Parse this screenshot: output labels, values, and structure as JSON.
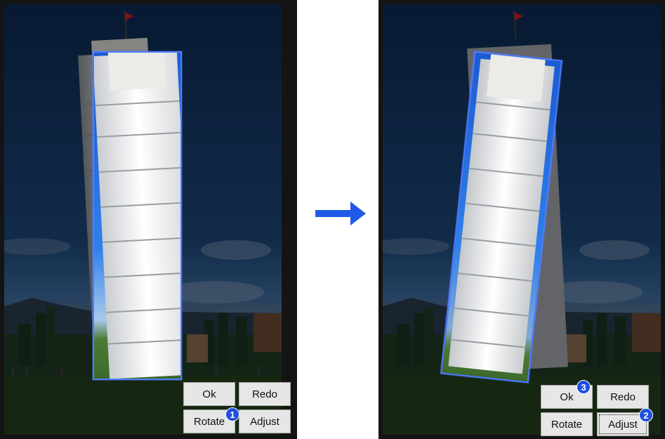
{
  "left_panel": {
    "photo_description_icon": "leaning-tower-photo",
    "buttons": {
      "ok": "Ok",
      "redo": "Redo",
      "rotate": "Rotate",
      "adjust": "Adjust"
    },
    "badges": {
      "rotate": "1"
    }
  },
  "transition": {
    "arrow_icon": "arrow-right-icon",
    "arrow_color": "#1f5be8"
  },
  "right_panel": {
    "buttons": {
      "ok": "Ok",
      "redo": "Redo",
      "rotate": "Rotate",
      "adjust": "Adjust"
    },
    "badges": {
      "ok": "3",
      "adjust": "2"
    }
  },
  "colors": {
    "selection_border": "#4f7dff",
    "badge": "#1f4fe0",
    "button_bg": "#e6e6e6"
  }
}
